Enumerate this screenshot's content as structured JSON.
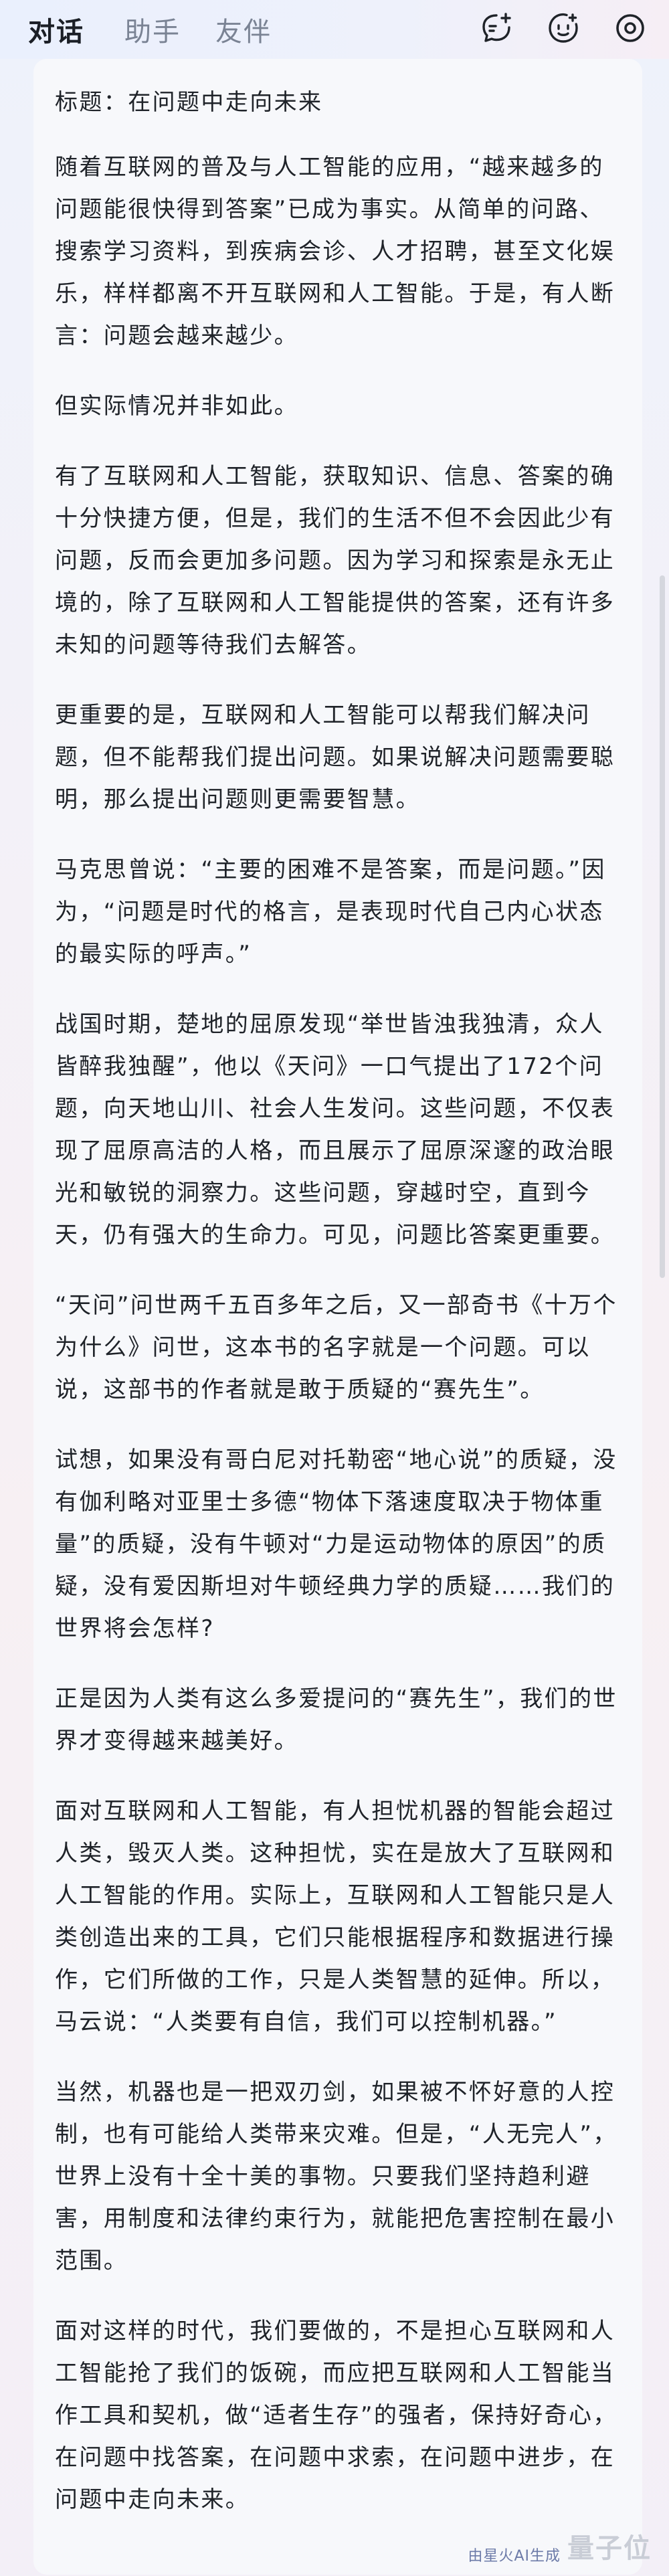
{
  "tabs": [
    {
      "label": "对话",
      "active": true
    },
    {
      "label": "助手",
      "active": false
    },
    {
      "label": "友伴",
      "active": false
    }
  ],
  "toolbar": {
    "icons": [
      "new-chat-icon",
      "face-icon",
      "settings-icon"
    ]
  },
  "article": {
    "paragraphs": [
      "标题：在问题中走向未来",
      "随着互联网的普及与人工智能的应用，“越来越多的问题能很快得到答案”已成为事实。从简单的问路、搜索学习资料，到疾病会诊、人才招聘，甚至文化娱乐，样样都离不开互联网和人工智能。于是，有人断言：问题会越来越少。",
      "但实际情况并非如此。",
      "有了互联网和人工智能，获取知识、信息、答案的确十分快捷方便，但是，我们的生活不但不会因此少有问题，反而会更加多问题。因为学习和探索是永无止境的，除了互联网和人工智能提供的答案，还有许多未知的问题等待我们去解答。",
      "更重要的是，互联网和人工智能可以帮我们解决问题，但不能帮我们提出问题。如果说解决问题需要聪明，那么提出问题则更需要智慧。",
      "马克思曾说：“主要的困难不是答案，而是问题。”因为，“问题是时代的格言，是表现时代自己内心状态的最实际的呼声。”",
      "战国时期，楚地的屈原发现“举世皆浊我独清，众人皆醉我独醒”，他以《天问》一口气提出了172个问题，向天地山川、社会人生发问。这些问题，不仅表现了屈原高洁的人格，而且展示了屈原深邃的政治眼光和敏锐的洞察力。这些问题，穿越时空，直到今天，仍有强大的生命力。可见，问题比答案更重要。",
      "“天问”问世两千五百多年之后，又一部奇书《十万个为什么》问世，这本书的名字就是一个问题。可以说，这部书的作者就是敢于质疑的“赛先生”。",
      "试想，如果没有哥白尼对托勒密“地心说”的质疑，没有伽利略对亚里士多德“物体下落速度取决于物体重量”的质疑，没有牛顿对“力是运动物体的原因”的质疑，没有爱因斯坦对牛顿经典力学的质疑……我们的世界将会怎样?",
      "正是因为人类有这么多爱提问的“赛先生”，我们的世界才变得越来越美好。",
      "面对互联网和人工智能，有人担忧机器的智能会超过人类，毁灭人类。这种担忧，实在是放大了互联网和人工智能的作用。实际上，互联网和人工智能只是人类创造出来的工具，它们只能根据程序和数据进行操作，它们所做的工作，只是人类智慧的延伸。所以，马云说：“人类要有自信，我们可以控制机器。”",
      "当然，机器也是一把双刃剑，如果被不怀好意的人控制，也有可能给人类带来灾难。但是，“人无完人”，世界上没有十全十美的事物。只要我们坚持趋利避害，用制度和法律约束行为，就能把危害控制在最小范围。",
      "面对这样的时代，我们要做的，不是担心互联网和人工智能抢了我们的饭碗，而应把互联网和人工智能当作工具和契机，做“适者生存”的强者，保持好奇心，在问题中找答案，在问题中求索，在问题中进步，在问题中走向未来。"
    ]
  },
  "watermark": {
    "label": "由星火AI生成",
    "logo": "量子位"
  }
}
